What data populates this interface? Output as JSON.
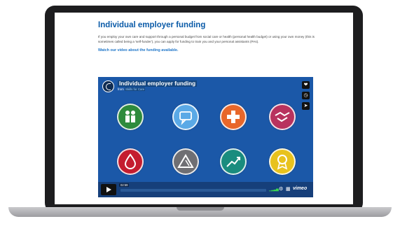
{
  "page": {
    "title": "Individual employer funding",
    "body": "If you employ your own care and support through a personal budget from social care or health (personal health budget) or using your own money (this is sometimes called being a 'self-funder'), you can apply for funding to train you and your personal assistants (PAs).",
    "video_link": "Watch our video about the funding available."
  },
  "player": {
    "title": "Individual employer funding",
    "from_label": "from",
    "byline": "Skills for Care",
    "time": "02:59",
    "brand": "vimeo",
    "side_buttons": [
      "heart-icon",
      "clock-icon",
      "send-icon"
    ],
    "colors": {
      "background": "#1b58a8",
      "control_bar": "#163f7a",
      "volume": "#39d353"
    }
  },
  "video_frame": {
    "icons": [
      {
        "name": "people-icon",
        "color": "#2e8b3d"
      },
      {
        "name": "speech-bubble-icon",
        "color": "#5aa9e6"
      },
      {
        "name": "plus-icon",
        "color": "#e8672a"
      },
      {
        "name": "handshake-icon",
        "color": "#b8325e"
      },
      {
        "name": "drop-icon",
        "color": "#c41d2f"
      },
      {
        "name": "triangle-icon",
        "color": "#6f6f73"
      },
      {
        "name": "trend-line-icon",
        "color": "#1a8c7e"
      },
      {
        "name": "rosette-icon",
        "color": "#e8c21d"
      }
    ]
  }
}
